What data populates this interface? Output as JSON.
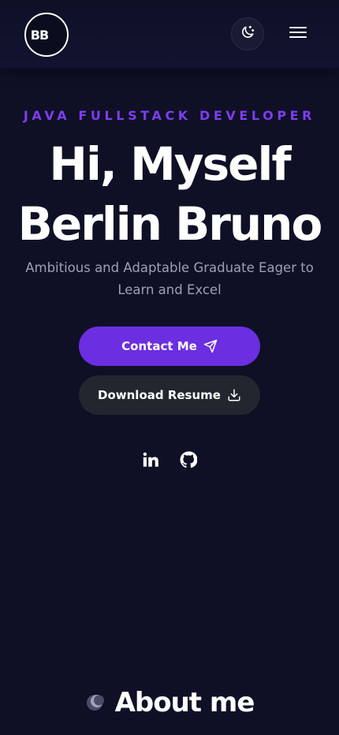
{
  "header": {
    "logo_text": "BB",
    "theme_icon": "moon-stars-icon",
    "menu_icon": "hamburger-menu-icon"
  },
  "hero": {
    "role": "JAVA FULLSTACK DEVELOPER",
    "title_line1": "Hi, Myself",
    "title_line2": "Berlin Bruno",
    "tagline": "Ambitious and Adaptable Graduate Eager to Learn and Excel",
    "contact_label": "Contact Me",
    "contact_icon": "send-icon",
    "resume_label": "Download Resume",
    "resume_icon": "download-icon"
  },
  "socials": [
    {
      "icon": "linkedin-icon"
    },
    {
      "icon": "github-icon"
    }
  ],
  "about": {
    "title": "About me",
    "icon": "moon-orb-icon"
  },
  "colors": {
    "background": "#0f1026",
    "accent": "#6b2ee0",
    "role_text": "#7d3df0",
    "secondary_button": "#23262f",
    "muted_text": "#9e9fb5"
  }
}
